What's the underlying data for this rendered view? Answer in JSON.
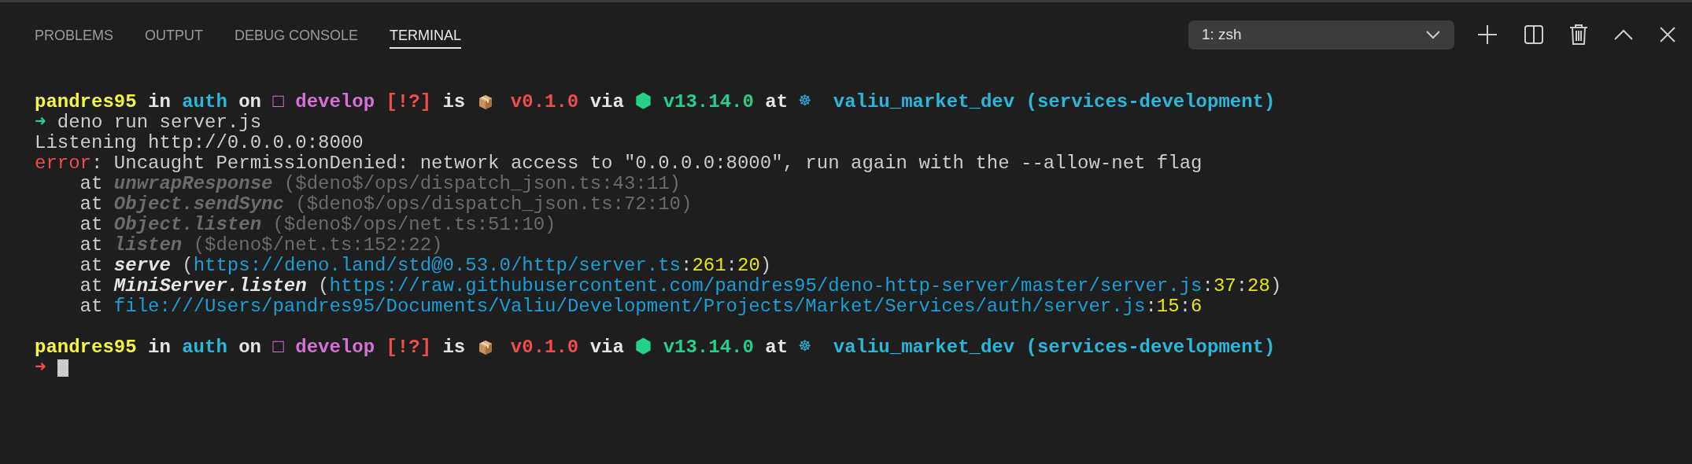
{
  "tabs": [
    {
      "label": "PROBLEMS",
      "selected": false
    },
    {
      "label": "OUTPUT",
      "selected": false
    },
    {
      "label": "DEBUG CONSOLE",
      "selected": false
    },
    {
      "label": "TERMINAL",
      "selected": true
    }
  ],
  "terminal_selector": {
    "value": "1: zsh"
  },
  "terminal": {
    "lines": [
      {
        "kind": "prompt",
        "segments": [
          {
            "text": "pandres95",
            "kind": "user"
          },
          {
            "text": "in",
            "kind": "bold"
          },
          {
            "text": "auth",
            "kind": "cyan-bold"
          },
          {
            "text": "on",
            "kind": "bold"
          },
          {
            "text": "□ develop",
            "kind": "magenta-bold"
          },
          {
            "text": "[!?]",
            "kind": "red-bold"
          },
          {
            "text": "is",
            "kind": "bold"
          },
          {
            "kind": "package-icon"
          },
          {
            "text": "v0.1.0",
            "kind": "red-bold"
          },
          {
            "text": "via",
            "kind": "bold"
          },
          {
            "text": "⬢ v13.14.0",
            "kind": "green-bold"
          },
          {
            "text": "at",
            "kind": "bold"
          },
          {
            "text": "☸  valiu_market_dev (services-development)",
            "kind": "cyan-bold"
          }
        ]
      },
      {
        "kind": "text",
        "segments": [
          {
            "text": "➜",
            "kind": "green"
          },
          {
            "text": " deno run server.js",
            "kind": "plain"
          }
        ]
      },
      {
        "kind": "text",
        "segments": [
          {
            "text": "Listening http://0.0.0.0:8000",
            "kind": "plain"
          }
        ]
      },
      {
        "kind": "text",
        "segments": [
          {
            "text": "error",
            "kind": "red"
          },
          {
            "text": ": Uncaught PermissionDenied: network access to \"0.0.0.0:8000\", run again with the --allow-net flag",
            "kind": "plain"
          }
        ]
      },
      {
        "kind": "text",
        "segments": [
          {
            "text": "    at ",
            "kind": "plain"
          },
          {
            "text": "unwrapResponse",
            "kind": "dim-bold-italic"
          },
          {
            "text": " ($deno$/ops/dispatch_json.ts:43:11)",
            "kind": "dim"
          }
        ]
      },
      {
        "kind": "text",
        "segments": [
          {
            "text": "    at ",
            "kind": "plain"
          },
          {
            "text": "Object.sendSync",
            "kind": "dim-bold-italic"
          },
          {
            "text": " ($deno$/ops/dispatch_json.ts:72:10)",
            "kind": "dim"
          }
        ]
      },
      {
        "kind": "text",
        "segments": [
          {
            "text": "    at ",
            "kind": "plain"
          },
          {
            "text": "Object.listen",
            "kind": "dim-bold-italic"
          },
          {
            "text": " ($deno$/ops/net.ts:51:10)",
            "kind": "dim"
          }
        ]
      },
      {
        "kind": "text",
        "segments": [
          {
            "text": "    at ",
            "kind": "plain"
          },
          {
            "text": "listen",
            "kind": "dim-bold-italic"
          },
          {
            "text": " ($deno$/net.ts:152:22)",
            "kind": "dim"
          }
        ]
      },
      {
        "kind": "text",
        "segments": [
          {
            "text": "    at ",
            "kind": "plain"
          },
          {
            "text": "serve",
            "kind": "bold-italic"
          },
          {
            "text": " (",
            "kind": "plain"
          },
          {
            "text": "https://deno.land/std@0.53.0/http/server.ts",
            "kind": "link"
          },
          {
            "text": ":",
            "kind": "plain"
          },
          {
            "text": "261",
            "kind": "number"
          },
          {
            "text": ":",
            "kind": "plain"
          },
          {
            "text": "20",
            "kind": "number"
          },
          {
            "text": ")",
            "kind": "plain"
          }
        ]
      },
      {
        "kind": "text",
        "segments": [
          {
            "text": "    at ",
            "kind": "plain"
          },
          {
            "text": "MiniServer.listen",
            "kind": "bold-italic"
          },
          {
            "text": " (",
            "kind": "plain"
          },
          {
            "text": "https://raw.githubusercontent.com/pandres95/deno-http-server/master/server.js",
            "kind": "link"
          },
          {
            "text": ":",
            "kind": "plain"
          },
          {
            "text": "37",
            "kind": "number"
          },
          {
            "text": ":",
            "kind": "plain"
          },
          {
            "text": "28",
            "kind": "number"
          },
          {
            "text": ")",
            "kind": "plain"
          }
        ]
      },
      {
        "kind": "text",
        "segments": [
          {
            "text": "    at ",
            "kind": "plain"
          },
          {
            "text": "file:///Users/pandres95/Documents/Valiu/Development/Projects/Market/Services/auth/server.js",
            "kind": "link"
          },
          {
            "text": ":",
            "kind": "plain"
          },
          {
            "text": "15",
            "kind": "number"
          },
          {
            "text": ":",
            "kind": "plain"
          },
          {
            "text": "6",
            "kind": "number"
          }
        ]
      },
      {
        "kind": "blank"
      },
      {
        "kind": "prompt",
        "segments": [
          {
            "text": "pandres95",
            "kind": "user"
          },
          {
            "text": "in",
            "kind": "bold"
          },
          {
            "text": "auth",
            "kind": "cyan-bold"
          },
          {
            "text": "on",
            "kind": "bold"
          },
          {
            "text": "□ develop",
            "kind": "magenta-bold"
          },
          {
            "text": "[!?]",
            "kind": "red-bold"
          },
          {
            "text": "is",
            "kind": "bold"
          },
          {
            "kind": "package-icon"
          },
          {
            "text": "v0.1.0",
            "kind": "red-bold"
          },
          {
            "text": "via",
            "kind": "bold"
          },
          {
            "text": "⬢ v13.14.0",
            "kind": "green-bold"
          },
          {
            "text": "at",
            "kind": "bold"
          },
          {
            "text": "☸  valiu_market_dev (services-development)",
            "kind": "cyan-bold"
          }
        ]
      },
      {
        "kind": "input",
        "segments": [
          {
            "text": "➜",
            "kind": "red"
          }
        ]
      }
    ]
  }
}
